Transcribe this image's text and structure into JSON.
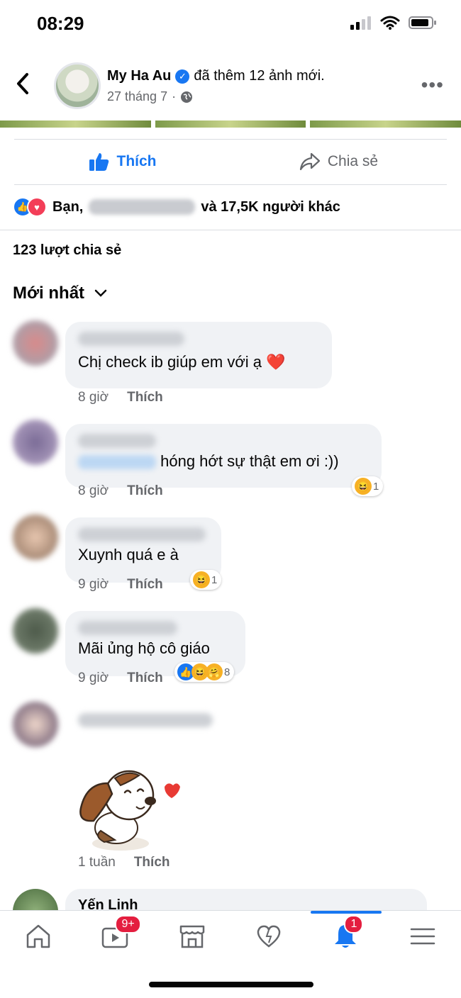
{
  "status_bar": {
    "time": "08:29"
  },
  "post_header": {
    "author": "My Ha Au",
    "action_text": "đã thêm 12 ảnh mới.",
    "date": "27 tháng 7",
    "separator": "·"
  },
  "actions": {
    "like_label": "Thích",
    "share_label": "Chia sẻ"
  },
  "reactions_summary": {
    "prefix": "Bạn,",
    "suffix": "và 17,5K người khác"
  },
  "shares_count": "123 lượt chia sẻ",
  "sort": {
    "label": "Mới nhất"
  },
  "comments": [
    {
      "text": "Chị check ib giúp em với ạ ❤️",
      "time": "8 giờ",
      "like_label": "Thích",
      "reaction_count": ""
    },
    {
      "text": "hóng hớt sự thật em ơi :))",
      "time": "8 giờ",
      "like_label": "Thích",
      "reaction_count": "1"
    },
    {
      "text": "Xuynh quá e à",
      "time": "9 giờ",
      "like_label": "Thích",
      "reaction_count": "1"
    },
    {
      "text": "Mãi ủng hộ cô giáo",
      "time": "9 giờ",
      "like_label": "Thích",
      "reaction_count": "8"
    },
    {
      "text": "",
      "time": "1 tuần",
      "like_label": "Thích",
      "reaction_count": ""
    },
    {
      "name": "Yến Linh"
    }
  ],
  "bottom_nav": {
    "video_badge": "9+",
    "notifications_badge": "1"
  },
  "colors": {
    "accent": "#1877f2",
    "badge": "#e41e3f",
    "secondary_text": "#65676b"
  }
}
